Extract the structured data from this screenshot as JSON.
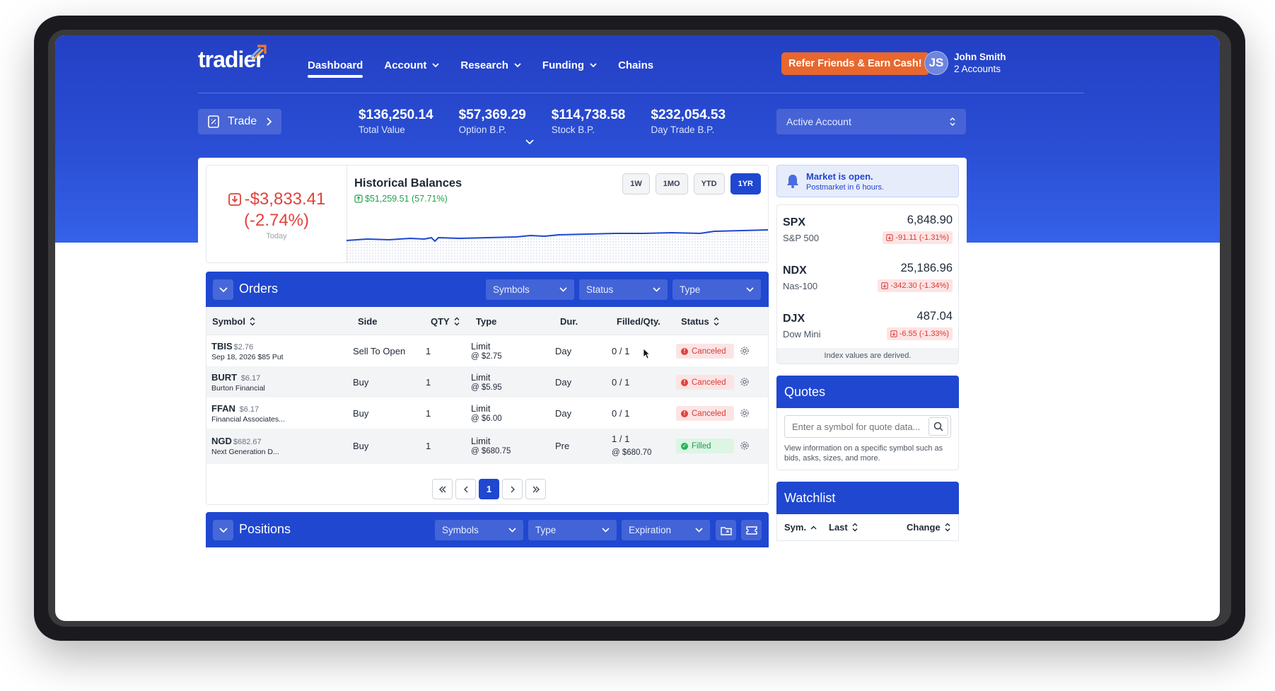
{
  "brand": {
    "logo_text": "tradier"
  },
  "nav": {
    "items": [
      {
        "label": "Dashboard",
        "dropdown": false,
        "active": true
      },
      {
        "label": "Account",
        "dropdown": true
      },
      {
        "label": "Research",
        "dropdown": true
      },
      {
        "label": "Funding",
        "dropdown": true
      },
      {
        "label": "Chains",
        "dropdown": false
      }
    ],
    "refer_button": "Refer Friends & Earn Cash!",
    "user": {
      "initials": "JS",
      "name": "John Smith",
      "accounts": "2 Accounts"
    }
  },
  "subbar": {
    "trade_label": "Trade",
    "stats": [
      {
        "value": "$136,250.14",
        "label": "Total Value"
      },
      {
        "value": "$57,369.29",
        "label": "Option B.P."
      },
      {
        "value": "$114,738.58",
        "label": "Stock B.P."
      },
      {
        "value": "$232,054.53",
        "label": "Day Trade B.P."
      }
    ],
    "account_select": "Active Account"
  },
  "today": {
    "amount": "-$3,833.41",
    "percent": "(-2.74%)",
    "label": "Today"
  },
  "historical": {
    "title": "Historical Balances",
    "change": "$51,259.51 (57.71%)",
    "ranges": [
      "1W",
      "1MO",
      "YTD",
      "1YR"
    ],
    "active_range": "1YR"
  },
  "orders": {
    "title": "Orders",
    "filters": [
      "Symbols",
      "Status",
      "Type"
    ],
    "columns": [
      "Symbol",
      "Side",
      "QTY",
      "Type",
      "Dur.",
      "Filled/Qty.",
      "Status"
    ],
    "rows": [
      {
        "symbol": "TBIS",
        "price": "$2.76",
        "desc": "Sep 18, 2026 $85 Put",
        "side": "Sell To Open",
        "qty": "1",
        "type": "Limit",
        "limit": "@ $2.75",
        "dur": "Day",
        "filled": "0 / 1",
        "filled_sub": "",
        "status": "Canceled"
      },
      {
        "symbol": "BURT",
        "price": "$6.17",
        "desc": "Burton Financial",
        "side": "Buy",
        "qty": "1",
        "type": "Limit",
        "limit": "@ $5.95",
        "dur": "Day",
        "filled": "0 / 1",
        "filled_sub": "",
        "status": "Canceled"
      },
      {
        "symbol": "FFAN",
        "price": "$6.17",
        "desc": "Financial Associates...",
        "side": "Buy",
        "qty": "1",
        "type": "Limit",
        "limit": "@ $6.00",
        "dur": "Day",
        "filled": "0 / 1",
        "filled_sub": "",
        "status": "Canceled"
      },
      {
        "symbol": "NGD",
        "price": "$682.67",
        "desc": "Next Generation D...",
        "side": "Buy",
        "qty": "1",
        "type": "Limit",
        "limit": "@ $680.75",
        "dur": "Pre",
        "filled": "1 / 1",
        "filled_sub": "@ $680.70",
        "status": "Filled"
      }
    ],
    "pagination": {
      "current": "1"
    }
  },
  "positions": {
    "title": "Positions",
    "filters": [
      "Symbols",
      "Type",
      "Expiration"
    ]
  },
  "market": {
    "title": "Market is open.",
    "subtitle": "Postmarket in 6 hours."
  },
  "indices": {
    "items": [
      {
        "symbol": "SPX",
        "name": "S&P 500",
        "value": "6,848.90",
        "change": "-91.11 (-1.31%)"
      },
      {
        "symbol": "NDX",
        "name": "Nas-100",
        "value": "25,186.96",
        "change": "-342.30 (-1.34%)"
      },
      {
        "symbol": "DJX",
        "name": "Dow Mini",
        "value": "487.04",
        "change": "-6.55 (-1.33%)"
      }
    ],
    "note": "Index values are derived."
  },
  "quotes": {
    "title": "Quotes",
    "placeholder": "Enter a symbol for quote data...",
    "help": "View information on a specific symbol such as bids, asks, sizes, and more."
  },
  "watchlist": {
    "title": "Watchlist",
    "columns": [
      "Sym.",
      "Last",
      "Change"
    ]
  },
  "colors": {
    "primary": "#1f47d0",
    "accent": "#e8672e",
    "negative": "#d63b35",
    "positive": "#1f9a48"
  }
}
